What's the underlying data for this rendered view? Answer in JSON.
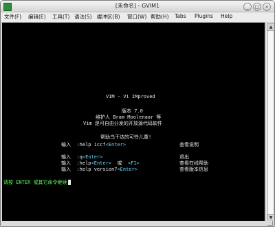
{
  "window": {
    "title": "[未命名] - GVIM1",
    "btn_minimize": "_",
    "btn_maximize": "□",
    "btn_close": "×"
  },
  "menu": [
    "文件(F)",
    "编辑(E)",
    "工具(T)",
    "语法(S)",
    "缓冲区(B)",
    "窗口(W)",
    "帮助(H)",
    "Tabs",
    "Plugins",
    "Help"
  ],
  "splash": {
    "l1": "VIM - Vi IMproved",
    "l2": "版本 7.0",
    "l3": "维护人 Bram Moolenaar 等",
    "l4": "Vim 是可自由分发的开放源代码软件",
    "l5": "帮助乌干达的可怜儿童!",
    "r1_pre": "输入  :help iccf",
    "r1_key": "<Enter>",
    "r1_desc": "查看说明",
    "r2_pre": "输入  :q",
    "r2_key": "<Enter>",
    "r2_desc": "退出",
    "r3_pre": "输入  :help",
    "r3_key1": "<Enter>",
    "r3_mid": "  或  ",
    "r3_key2": "<F1>",
    "r3_desc": "查看在线帮助",
    "r4_pre": "输入  :help version7",
    "r4_key": "<Enter>",
    "r4_desc": "查看版本信息"
  },
  "cmdline": "请按 ENTER 或其它命令继续",
  "colors": {
    "terminal_bg": "#000000",
    "text": "#e8e8e8",
    "highlight": "#67d8ff",
    "prompt": "#5cff5c"
  }
}
